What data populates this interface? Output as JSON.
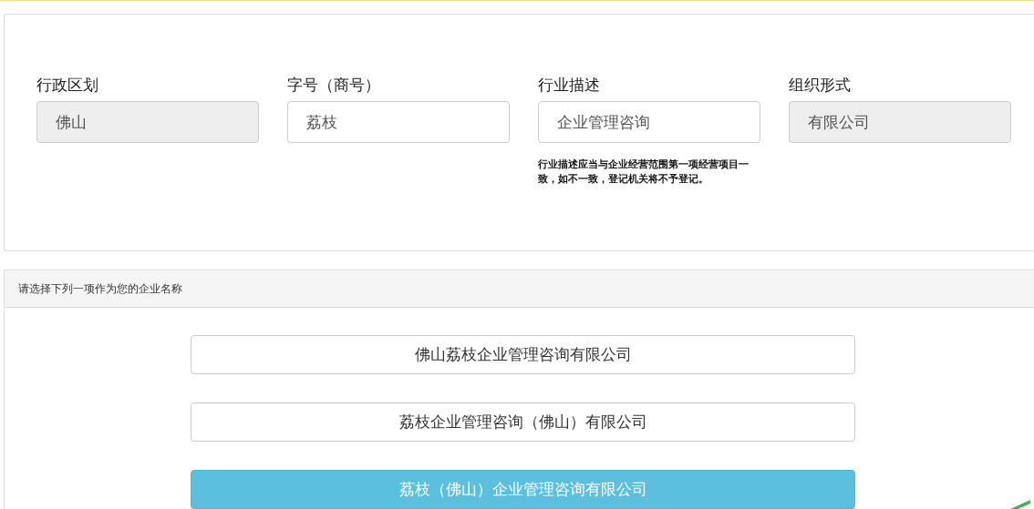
{
  "fields": [
    {
      "label": "行政区划",
      "value": "佛山",
      "disabled": true
    },
    {
      "label": "字号（商号）",
      "value": "荔枝",
      "disabled": false
    },
    {
      "label": "行业描述",
      "value": "企业管理咨询",
      "disabled": false,
      "hint": "行业描述应当与企业经营范围第一项经营项目一致，如不一致，登记机关将不予登记。"
    },
    {
      "label": "组织形式",
      "value": "有限公司",
      "disabled": true
    }
  ],
  "name_panel": {
    "title": "请选择下列一项作为您的企业名称",
    "options": [
      {
        "label": "佛山荔枝企业管理咨询有限公司",
        "selected": false
      },
      {
        "label": "荔枝企业管理咨询（佛山）有限公司",
        "selected": false
      },
      {
        "label": "荔枝（佛山）企业管理咨询有限公司",
        "selected": true
      }
    ]
  }
}
